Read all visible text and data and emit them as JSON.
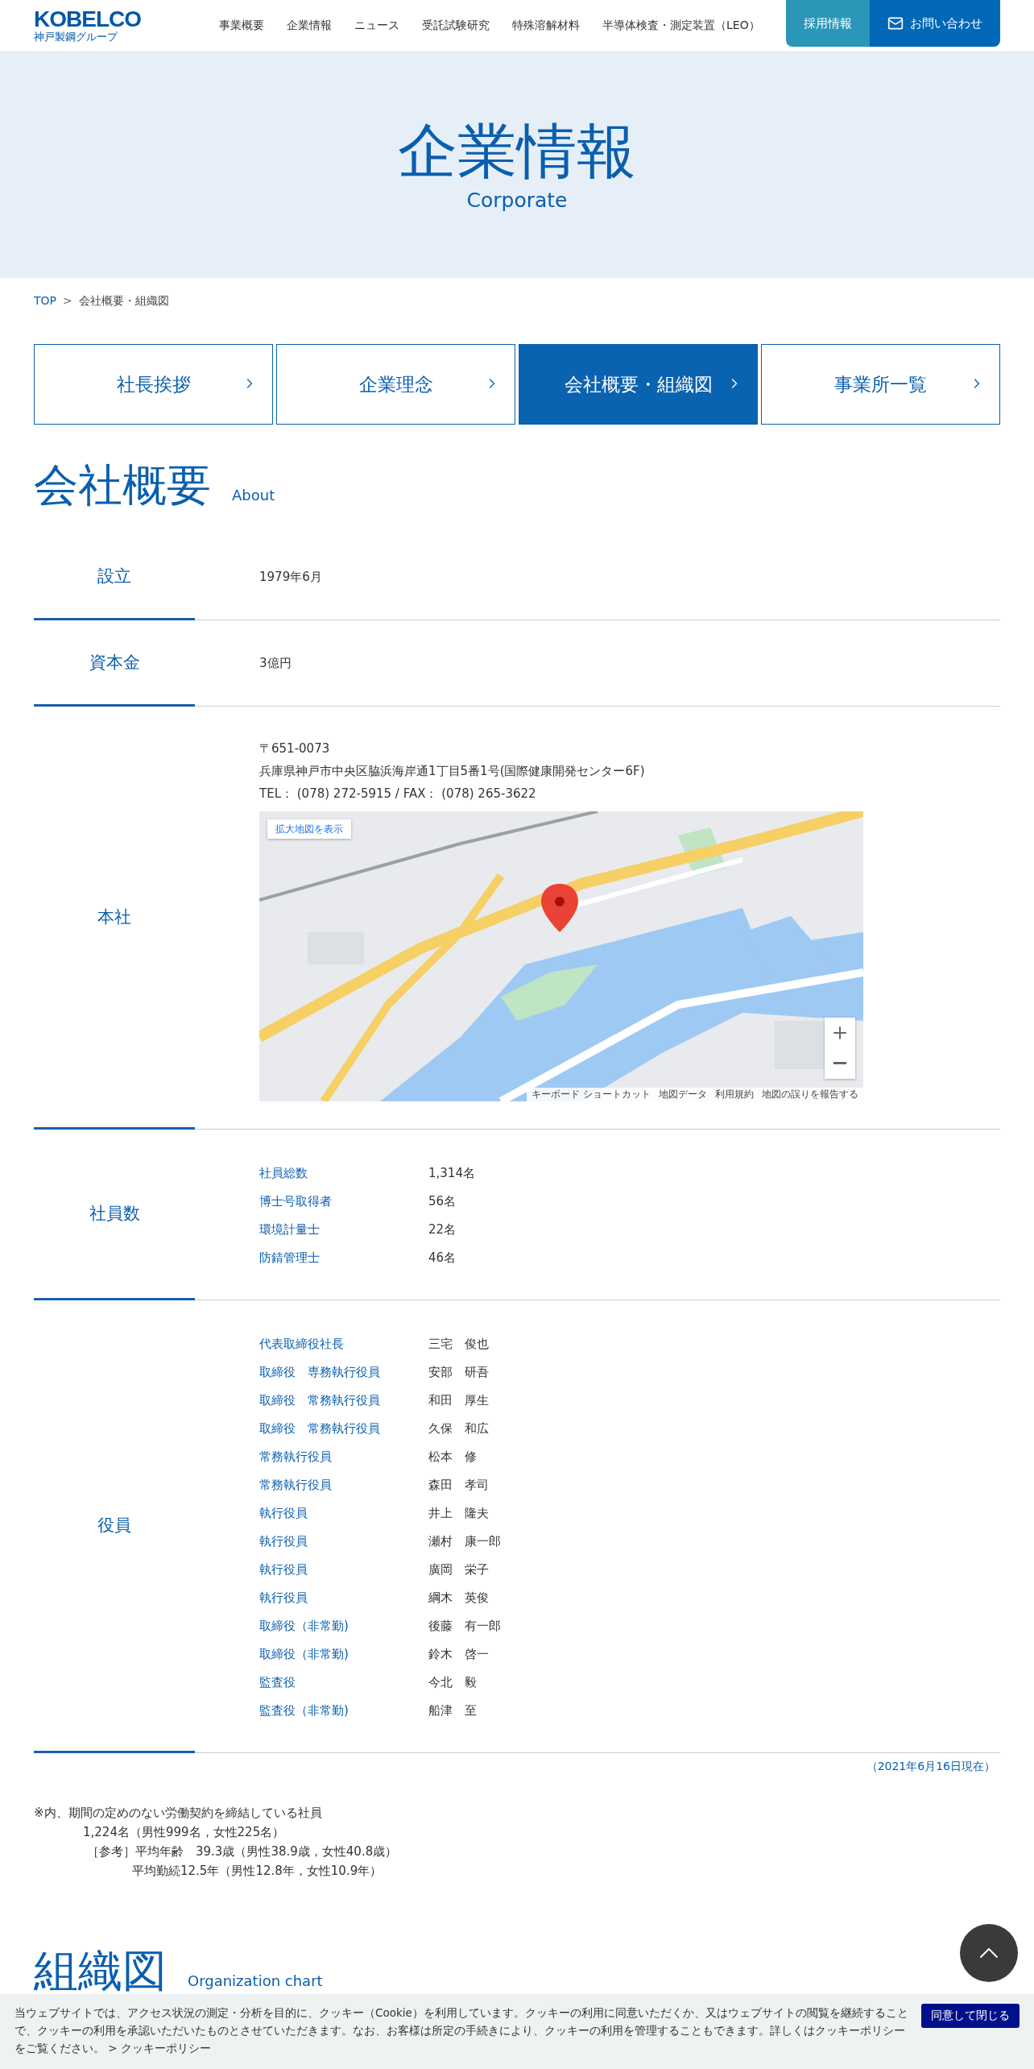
{
  "header": {
    "logo": "KOBELCO",
    "logo_sub": "神戸製鋼グループ",
    "nav": [
      "事業概要",
      "企業情報",
      "ニュース",
      "受託試験研究",
      "特殊溶解材料",
      "半導体検査・測定装置（LEO）"
    ],
    "buttons": [
      {
        "label": "採用情報",
        "kind": "recruit"
      },
      {
        "label": "お問い合わせ",
        "kind": "contact"
      }
    ]
  },
  "hero": {
    "title": "企業情報",
    "subtitle": "Corporate"
  },
  "breadcrumb": [
    {
      "label": "TOP",
      "kind": "link"
    },
    {
      "label": "会社概要・組織図",
      "kind": "current"
    }
  ],
  "breadcrumb_separator": ">",
  "tabs": [
    {
      "label": "社長挨拶",
      "selected": false
    },
    {
      "label": "企業理念",
      "selected": false
    },
    {
      "label": "会社概要・組織図",
      "selected": true
    },
    {
      "label": "事業所一覧",
      "selected": false
    }
  ],
  "section": {
    "title": "会社概要",
    "subtitle": "About"
  },
  "rows": [
    {
      "label": "設立",
      "kind": "text",
      "value": "1979年6月"
    },
    {
      "label": "資本金",
      "kind": "text",
      "value": "3億円"
    },
    {
      "label": "本社",
      "kind": "address",
      "lines": [
        "〒651-0073",
        "兵庫県神戸市中央区脇浜海岸通1丁目5番1号(国際健康開発センター6F)",
        "TEL： (078) 272-5915 / FAX： (078) 265-3622"
      ],
      "map": {
        "link": "拡大地図を表示",
        "attribution": [
          "キーボード ショートカット",
          "地図データ",
          "利用規約",
          "地図の誤りを報告する"
        ]
      }
    },
    {
      "label": "社員数",
      "kind": "list",
      "items": [
        {
          "term": "社員総数",
          "value": "1,314名"
        },
        {
          "term": "博士号取得者",
          "value": "56名"
        },
        {
          "term": "環境計量士",
          "value": "22名"
        },
        {
          "term": "防錆管理士",
          "value": "46名"
        }
      ]
    },
    {
      "label": "役員",
      "kind": "list",
      "items": [
        {
          "term": "代表取締役社長",
          "value": "三宅　俊也"
        },
        {
          "term": "取締役　専務執行役員",
          "value": "安部　研吾"
        },
        {
          "term": "取締役　常務執行役員",
          "value": "和田　厚生"
        },
        {
          "term": "取締役　常務執行役員",
          "value": "久保　和広"
        },
        {
          "term": "常務執行役員",
          "value": "松本　修"
        },
        {
          "term": "常務執行役員",
          "value": "森田　孝司"
        },
        {
          "term": "執行役員",
          "value": "井上　隆夫"
        },
        {
          "term": "執行役員",
          "value": "瀬村　康一郎"
        },
        {
          "term": "執行役員",
          "value": "廣岡　栄子"
        },
        {
          "term": "執行役員",
          "value": "綱木　英俊"
        },
        {
          "term": "取締役（非常勤)",
          "value": "後藤　有一郎"
        },
        {
          "term": "取締役（非常勤)",
          "value": "鈴木　啓一"
        },
        {
          "term": "監査役",
          "value": "今北　毅"
        },
        {
          "term": "監査役（非常勤)",
          "value": "船津　至"
        }
      ]
    }
  ],
  "date_note": "（2021年6月16日現在）",
  "notes": [
    {
      "kind": "main",
      "text": "※内、期間の定めのない労働契約を締結している社員"
    },
    {
      "kind": "count",
      "text": "1,224名（男性999名，女性225名）"
    },
    {
      "kind": "ref",
      "label": "［参考］",
      "text": "平均年齢　39.3歳（男性38.9歳，女性40.8歳）"
    },
    {
      "kind": "cont",
      "text": "平均勤続12.5年（男性12.8年，女性10.9年）"
    }
  ],
  "org_section": {
    "title": "組織図",
    "subtitle": "Organization chart"
  },
  "cookie": {
    "text": "当ウェブサイトでは、アクセス状況の測定・分析を目的に、クッキー（Cookie）を利用しています。クッキーの利用に同意いただくか、又はウェブサイトの閲覧を継続することで、クッキーの利用を承認いただいたものとさせていただきます。なお、お客様は所定の手続きにより、クッキーの利用を管理することもできます。詳しくはクッキーポリシーをご覧ください。",
    "link": "> クッキーポリシー",
    "button": "同意して閉じる"
  }
}
